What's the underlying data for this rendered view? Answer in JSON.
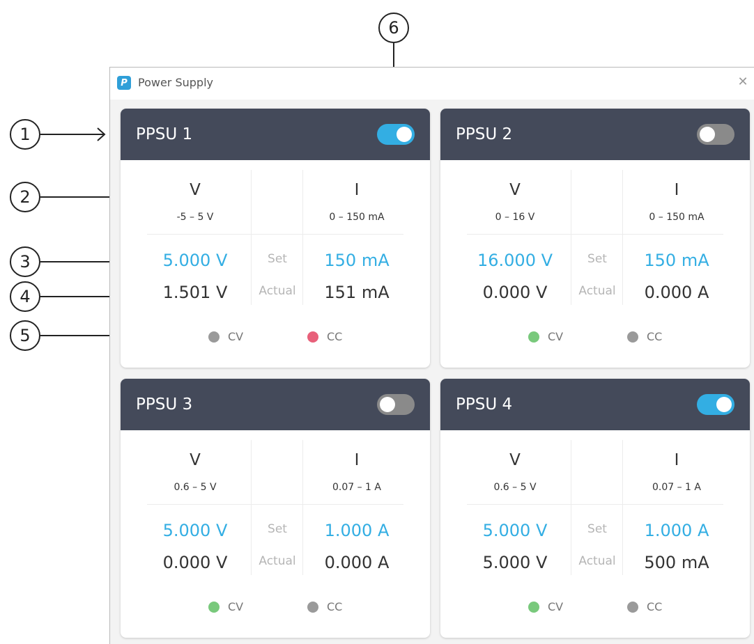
{
  "window": {
    "title": "Power Supply",
    "close_icon": "close-icon",
    "app_icon": "power-supply-app-icon"
  },
  "labels": {
    "set": "Set",
    "actual": "Actual",
    "cv": "CV",
    "cc": "CC"
  },
  "callouts": [
    "1",
    "2",
    "3",
    "4",
    "5",
    "6"
  ],
  "colors": {
    "header": "#444a5a",
    "accent": "#33aee3",
    "toggle_off": "#8a8a8a",
    "indicator_off": "#9a9a9a",
    "indicator_cv_on": "#79c97c",
    "indicator_cc_on": "#e8607a"
  },
  "channels": [
    {
      "name": "PPSU 1",
      "enabled": true,
      "v": {
        "head": "V",
        "range": "-5 – 5 V",
        "set": "5.000 V",
        "actual": "1.501 V"
      },
      "i": {
        "head": "I",
        "range": "0 – 150 mA",
        "set": "150 mA",
        "actual": "151 mA"
      },
      "cv_active": false,
      "cc_active": true
    },
    {
      "name": "PPSU 2",
      "enabled": false,
      "v": {
        "head": "V",
        "range": "0 – 16 V",
        "set": "16.000 V",
        "actual": "0.000 V"
      },
      "i": {
        "head": "I",
        "range": "0 – 150 mA",
        "set": "150 mA",
        "actual": "0.000 A"
      },
      "cv_active": true,
      "cc_active": false
    },
    {
      "name": "PPSU 3",
      "enabled": false,
      "v": {
        "head": "V",
        "range": "0.6 – 5 V",
        "set": "5.000 V",
        "actual": "0.000 V"
      },
      "i": {
        "head": "I",
        "range": "0.07 – 1 A",
        "set": "1.000 A",
        "actual": "0.000 A"
      },
      "cv_active": true,
      "cc_active": false
    },
    {
      "name": "PPSU 4",
      "enabled": true,
      "v": {
        "head": "V",
        "range": "0.6 – 5 V",
        "set": "5.000 V",
        "actual": "5.000 V"
      },
      "i": {
        "head": "I",
        "range": "0.07 – 1 A",
        "set": "1.000 A",
        "actual": "500 mA"
      },
      "cv_active": true,
      "cc_active": false
    }
  ]
}
